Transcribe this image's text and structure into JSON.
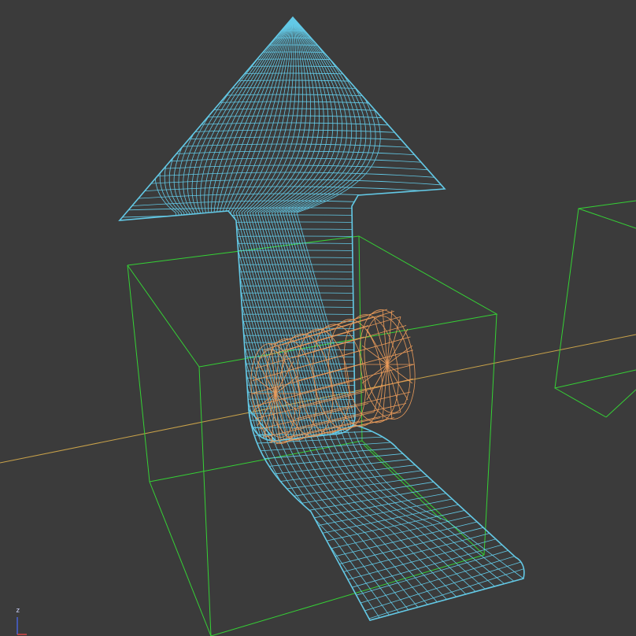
{
  "viewport": {
    "background": "#3b3b3b",
    "view": "perspective",
    "shading": "wireframe"
  },
  "colors": {
    "arrow_wire": "#63c9e6",
    "cylinder_wire": "#e89a5a",
    "lattice_box": "#35d135",
    "ground_axis": "#c9a24a",
    "gizmo_z": "#4a6cff",
    "gizmo_x": "#ff4a4a"
  },
  "objects": [
    {
      "name": "arrow",
      "type": "mesh",
      "wireframe": true,
      "shape": "bent-arrow"
    },
    {
      "name": "cylinder",
      "type": "mesh",
      "wireframe": true,
      "shape": "cylinder"
    },
    {
      "name": "box-lattice-1",
      "type": "lattice",
      "shape": "box"
    },
    {
      "name": "box-lattice-2",
      "type": "lattice",
      "shape": "box"
    }
  ],
  "axis_gizmo": {
    "z_label": "z"
  }
}
